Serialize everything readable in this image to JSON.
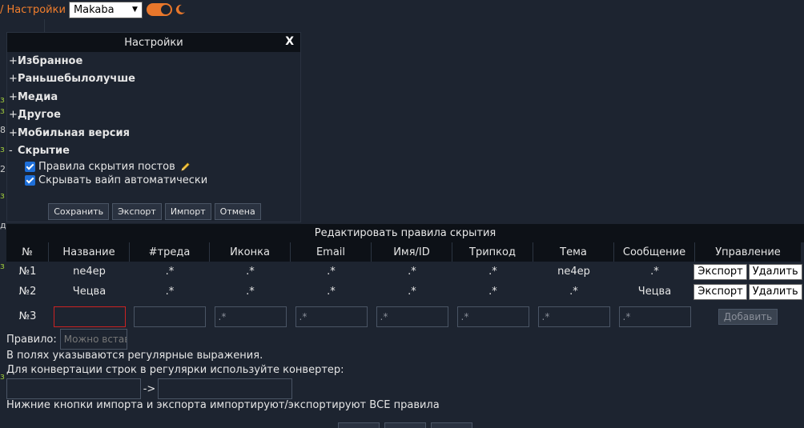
{
  "topbar": {
    "settings_label": "/ Настройки",
    "style_selected": "Makaba"
  },
  "edge_marks": [
    "з",
    "з",
    "8",
    "з",
    "з",
    "з",
    "2",
    "з",
    "д"
  ],
  "settings": {
    "title": "Настройки",
    "close": "X",
    "sections": [
      {
        "sign": "+",
        "label": "Избранное"
      },
      {
        "sign": "+",
        "label": "Раньшебылолучше"
      },
      {
        "sign": "+",
        "label": "Медиа"
      },
      {
        "sign": "+",
        "label": "Другое"
      },
      {
        "sign": "+",
        "label": "Мобильная версия"
      },
      {
        "sign": "-",
        "label": "Скрытие"
      }
    ],
    "options": [
      {
        "label": "Правила скрытия постов",
        "checked": true
      },
      {
        "label": "Скрывать вайп автоматически",
        "checked": true
      }
    ],
    "buttons": [
      "Сохранить",
      "Экспорт",
      "Импорт",
      "Отмена"
    ]
  },
  "rules": {
    "title": "Редактировать правила скрытия",
    "columns": [
      "№",
      "Название",
      "#треда",
      "Иконка",
      "Email",
      "Имя/ID",
      "Трипкод",
      "Тема",
      "Сообщение",
      "Управление"
    ],
    "rows": [
      {
        "num": "№1",
        "name": "ne4ep",
        "thread": ".*",
        "icon": ".*",
        "email": ".*",
        "nameid": ".*",
        "trip": ".*",
        "subject": "ne4ep",
        "message": ".*"
      },
      {
        "num": "№2",
        "name": "Чецва",
        "thread": ".*",
        "icon": ".*",
        "email": ".*",
        "nameid": ".*",
        "trip": ".*",
        "subject": ".*",
        "message": "Чецва"
      }
    ],
    "export_label": "Экспорт",
    "delete_label": "Удалить",
    "new_row": {
      "num": "№3",
      "placeholder": ".*",
      "add_label": "Добавить"
    },
    "rule_label": "Правило:",
    "rule_placeholder": "Можно вставить сохранённое",
    "help_1": "В полях указываются регулярные выражения.",
    "help_2": "Для конвертации строк в регулярки используйте конвертер:",
    "arrow": "->",
    "help_3": "Нижние кнопки импорта и экспорта импортируют/экспортируют ВСЕ правила"
  }
}
